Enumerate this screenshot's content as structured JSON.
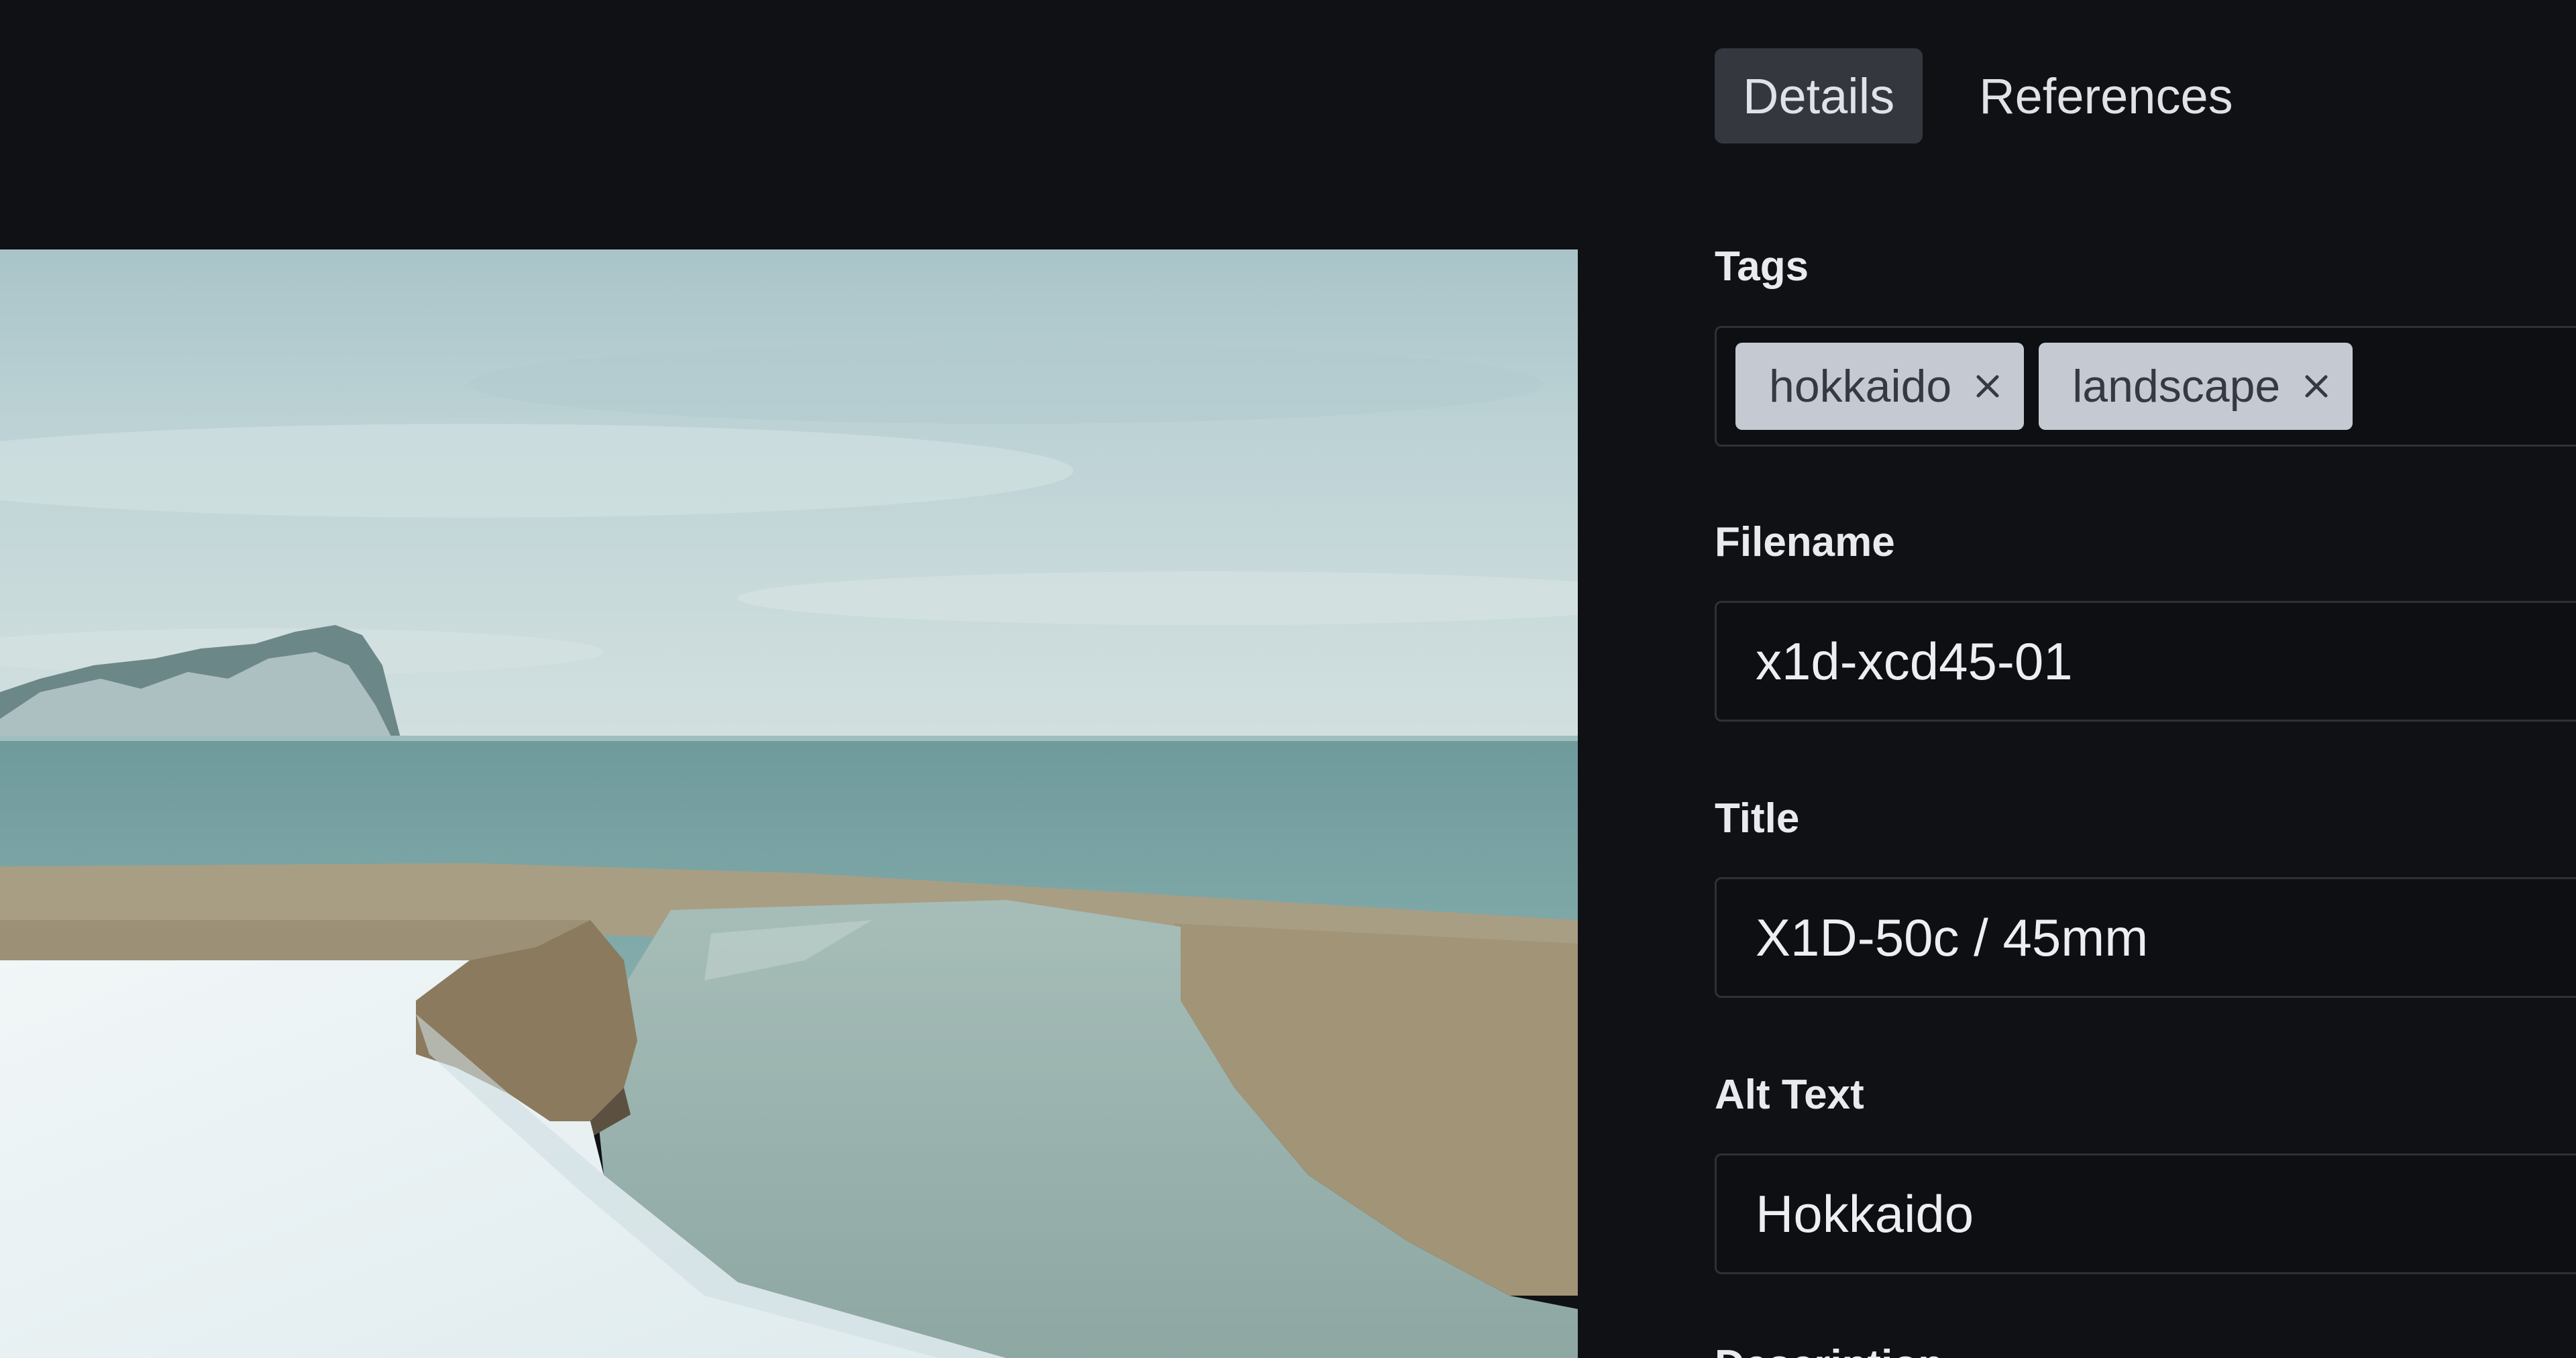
{
  "tabs": [
    {
      "label": "Details",
      "active": true
    },
    {
      "label": "References",
      "active": false
    }
  ],
  "fields": {
    "tags": {
      "label": "Tags",
      "items": [
        "hokkaido",
        "landscape"
      ]
    },
    "filename": {
      "label": "Filename",
      "value": "x1d-xcd45-01"
    },
    "title": {
      "label": "Title",
      "value": "X1D-50c / 45mm"
    },
    "alt_text": {
      "label": "Alt Text",
      "value": "Hokkaido"
    },
    "description": {
      "label": "Description"
    }
  },
  "icons": {
    "tag_remove": "close-icon"
  },
  "colors": {
    "background": "#0f1115",
    "active_tab": "#34383e",
    "tag_bg": "#c5cad2",
    "field_border": "#2d3138"
  }
}
